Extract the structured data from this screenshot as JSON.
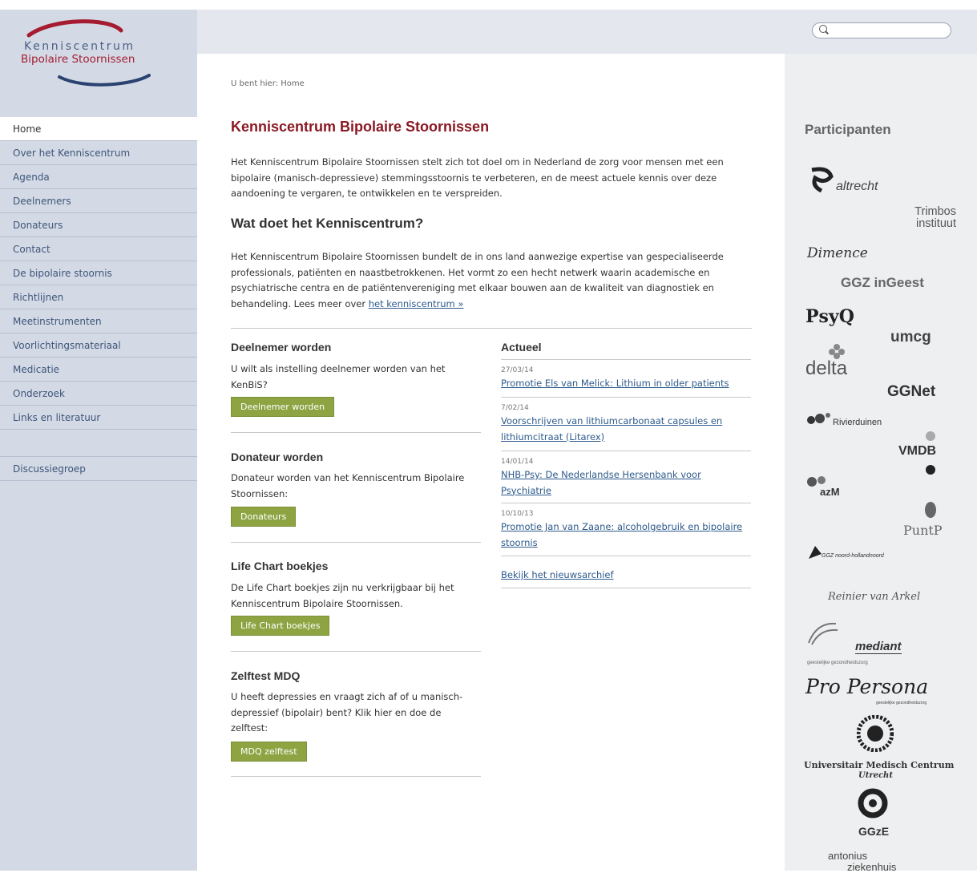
{
  "logo": {
    "line1": "Kenniscentrum",
    "line2": "Bipolaire Stoornissen"
  },
  "nav": {
    "items": [
      "Home",
      "Over het Kenniscentrum",
      "Agenda",
      "Deelnemers",
      "Donateurs",
      "Contact",
      "De bipolaire stoornis",
      "Richtlijnen",
      "Meetinstrumenten",
      "Voorlichtingsmateriaal",
      "Medicatie",
      "Onderzoek",
      "Links en literatuur"
    ],
    "extra": "Discussiegroep"
  },
  "breadcrumb": "U bent hier: Home",
  "page_title": "Kenniscentrum Bipolaire Stoornissen",
  "intro": "Het Kenniscentrum Bipolaire Stoornissen stelt zich tot doel om in Nederland de zorg voor mensen met een bipolaire (manisch-depressieve) stemmingsstoornis te verbeteren, en de meest actuele kennis over deze aandoening te vergaren, te ontwikkelen en te verspreiden.",
  "what_title": "Wat doet het Kenniscentrum?",
  "what_text": "Het Kenniscentrum Bipolaire Stoornissen bundelt de in ons land aanwezige expertise van gespecialiseerde professionals, patiënten en naastbetrokkenen. Het vormt zo een hecht netwerk waarin academische en psychiatrische centra en de patiëntenvereniging met elkaar bouwen aan de kwaliteit van diagnostiek en behandeling. Lees meer over",
  "what_link": "het kenniscentrum »",
  "boxes": [
    {
      "title": "Deelnemer worden",
      "text": "U wilt als instelling deelnemer worden van het KenBiS?",
      "button": "Deelnemer worden"
    },
    {
      "title": "Donateur worden",
      "text": "Donateur worden van het Kenniscentrum Bipolaire Stoornissen:",
      "button": "Donateurs"
    },
    {
      "title": "Life Chart boekjes",
      "text": "De Life Chart boekjes zijn nu verkrijgbaar bij het Kenniscentrum Bipolaire Stoornissen.",
      "button": "Life Chart boekjes"
    },
    {
      "title": "Zelftest MDQ",
      "text": "U heeft depressies en vraagt zich af of u manisch-depressief (bipolair) bent? Klik hier en doe de zelftest:",
      "button": "MDQ zelftest"
    }
  ],
  "news": {
    "title": "Actueel",
    "items": [
      {
        "date": "27/03/14",
        "title": "Promotie Els van Melick: Lithium in older patients"
      },
      {
        "date": "7/02/14",
        "title": "Voorschrijven van lithiumcarbonaat capsules en lithiumcitraat (Litarex)"
      },
      {
        "date": "14/01/14",
        "title": "NHB-Psy: De Nederlandse Hersenbank voor Psychiatrie"
      },
      {
        "date": "10/10/13",
        "title": "Promotie Jan van Zaane: alcoholgebruik en bipolaire stoornis"
      }
    ],
    "archive": "Bekijk het nieuwsarchief"
  },
  "participants": {
    "title": "Participanten",
    "logos": [
      "altrecht",
      "Trimbos instituut",
      "Dimence",
      "GGZ inGeest",
      "PsyQ",
      "umcg",
      "delta",
      "GGNet",
      "Rivierduinen",
      "VMDB",
      "azM",
      "PuntP",
      "GGZ noord-hollandnoord",
      "Reinier van Arkel",
      "mediant",
      "geestelijke gezondheidszorg",
      "Pro Persona",
      "geestelijke gezondheidszorg",
      "Universitair Medisch Centrum",
      "Utrecht",
      "GGzE",
      "antonius",
      "ziekenhuis"
    ]
  },
  "colors": {
    "sidebar": "#d3dae6",
    "title": "#8a1823",
    "button": "#8ea443",
    "link": "#2d5a8c"
  }
}
